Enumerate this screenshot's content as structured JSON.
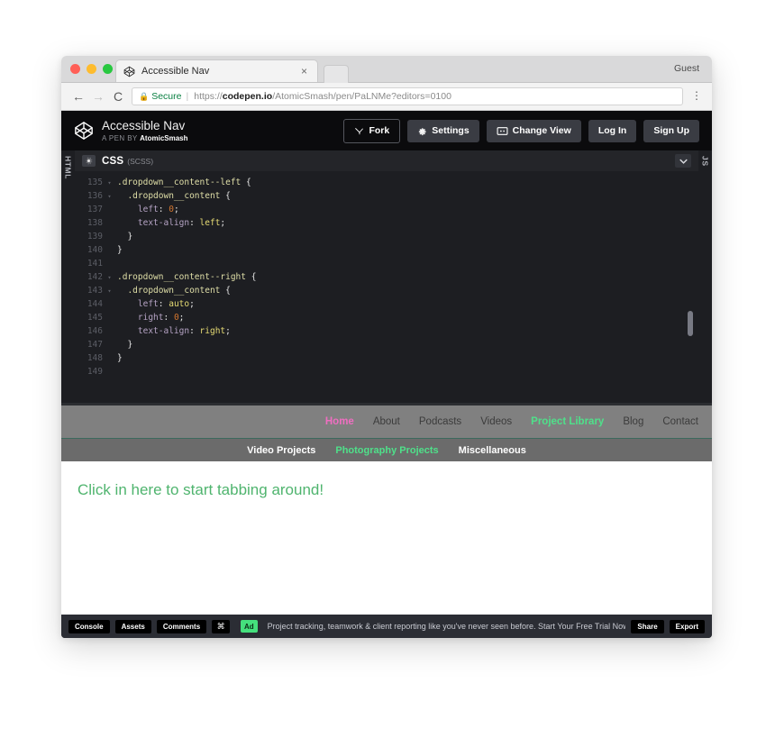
{
  "browser": {
    "tab": {
      "title": "Accessible Nav",
      "favicon": "codepen-logo-icon",
      "close": "×"
    },
    "guest_label": "Guest",
    "address": {
      "secure_label": "Secure",
      "lock": "lock-icon",
      "scheme": "https://",
      "host": "codepen.io",
      "path": "/AtomicSmash/pen/PaLNMe?editors=0100",
      "back": "←",
      "forward": "→",
      "reload": "C",
      "menu": "⋮"
    }
  },
  "pen_header": {
    "title": "Accessible Nav",
    "byline_prefix": "A PEN BY",
    "author": "AtomicSmash",
    "buttons": [
      {
        "label": "Fork",
        "icon": "fork-icon",
        "style": "outline"
      },
      {
        "label": "Settings",
        "icon": "gear-icon",
        "style": "solid"
      },
      {
        "label": "Change View",
        "icon": "layout-icon",
        "style": "solid"
      },
      {
        "label": "Log In",
        "icon": "",
        "style": "solid"
      },
      {
        "label": "Sign Up",
        "icon": "",
        "style": "solid"
      }
    ]
  },
  "editor": {
    "left_tab": "HTML",
    "right_tab": "JS",
    "language": "CSS",
    "sublanguage": "(SCSS)",
    "gear": "gear-icon",
    "collapse": "chevron-down-icon",
    "lines": [
      {
        "n": "135",
        "fold": "▾",
        "tokens": [
          {
            "t": ".dropdown__content--left ",
            "c": "t-sel"
          },
          {
            "t": "{",
            "c": "t-punc"
          }
        ],
        "indent": 0
      },
      {
        "n": "136",
        "fold": "▾",
        "tokens": [
          {
            "t": "  .dropdown__content ",
            "c": "t-sel"
          },
          {
            "t": "{",
            "c": "t-punc"
          }
        ],
        "indent": 0
      },
      {
        "n": "137",
        "fold": "",
        "tokens": [
          {
            "t": "    left",
            "c": "t-prop"
          },
          {
            "t": ": ",
            "c": "t-punc"
          },
          {
            "t": "0",
            "c": "t-num"
          },
          {
            "t": ";",
            "c": "t-punc"
          }
        ],
        "indent": 0
      },
      {
        "n": "138",
        "fold": "",
        "tokens": [
          {
            "t": "    text-align",
            "c": "t-prop"
          },
          {
            "t": ": ",
            "c": "t-punc"
          },
          {
            "t": "left",
            "c": "t-val"
          },
          {
            "t": ";",
            "c": "t-punc"
          }
        ],
        "indent": 0
      },
      {
        "n": "139",
        "fold": "",
        "tokens": [
          {
            "t": "  }",
            "c": "t-punc"
          }
        ],
        "indent": 0
      },
      {
        "n": "140",
        "fold": "",
        "tokens": [
          {
            "t": "}",
            "c": "t-punc"
          }
        ],
        "indent": 0
      },
      {
        "n": "141",
        "fold": "",
        "tokens": [
          {
            "t": "",
            "c": "t-punc"
          }
        ],
        "indent": 0
      },
      {
        "n": "142",
        "fold": "▾",
        "tokens": [
          {
            "t": ".dropdown__content--right ",
            "c": "t-sel"
          },
          {
            "t": "{",
            "c": "t-punc"
          }
        ],
        "indent": 0
      },
      {
        "n": "143",
        "fold": "▾",
        "tokens": [
          {
            "t": "  .dropdown__content ",
            "c": "t-sel"
          },
          {
            "t": "{",
            "c": "t-punc"
          }
        ],
        "indent": 0
      },
      {
        "n": "144",
        "fold": "",
        "tokens": [
          {
            "t": "    left",
            "c": "t-prop"
          },
          {
            "t": ": ",
            "c": "t-punc"
          },
          {
            "t": "auto",
            "c": "t-val"
          },
          {
            "t": ";",
            "c": "t-punc"
          }
        ],
        "indent": 0
      },
      {
        "n": "145",
        "fold": "",
        "tokens": [
          {
            "t": "    right",
            "c": "t-prop"
          },
          {
            "t": ": ",
            "c": "t-punc"
          },
          {
            "t": "0",
            "c": "t-num"
          },
          {
            "t": ";",
            "c": "t-punc"
          }
        ],
        "indent": 0
      },
      {
        "n": "146",
        "fold": "",
        "tokens": [
          {
            "t": "    text-align",
            "c": "t-prop"
          },
          {
            "t": ": ",
            "c": "t-punc"
          },
          {
            "t": "right",
            "c": "t-val"
          },
          {
            "t": ";",
            "c": "t-punc"
          }
        ],
        "indent": 0
      },
      {
        "n": "147",
        "fold": "",
        "tokens": [
          {
            "t": "  }",
            "c": "t-punc"
          }
        ],
        "indent": 0
      },
      {
        "n": "148",
        "fold": "",
        "tokens": [
          {
            "t": "}",
            "c": "t-punc"
          }
        ],
        "indent": 0
      },
      {
        "n": "149",
        "fold": "",
        "tokens": [
          {
            "t": "",
            "c": "t-punc"
          }
        ],
        "indent": 0
      }
    ]
  },
  "preview": {
    "primary_nav": [
      {
        "label": "Home",
        "state": "home"
      },
      {
        "label": "About",
        "state": ""
      },
      {
        "label": "Podcasts",
        "state": ""
      },
      {
        "label": "Videos",
        "state": ""
      },
      {
        "label": "Project Library",
        "state": "active"
      },
      {
        "label": "Blog",
        "state": ""
      },
      {
        "label": "Contact",
        "state": ""
      }
    ],
    "secondary_nav": [
      {
        "label": "Video Projects",
        "state": ""
      },
      {
        "label": "Photography Projects",
        "state": "active"
      },
      {
        "label": "Miscellaneous",
        "state": ""
      }
    ],
    "heading": "Click in here to start tabbing around!"
  },
  "bottom_bar": {
    "buttons": [
      "Console",
      "Assets",
      "Comments"
    ],
    "shortcut_icon": "⌘",
    "ad_badge": "Ad",
    "ad_text": "Project tracking, teamwork & client reporting like you've never seen before. Start Your Free Trial Now",
    "right_buttons": [
      "Share",
      "Export"
    ]
  },
  "colors": {
    "accent_green": "#4fe08a",
    "accent_pink": "#ef6ec1",
    "secure_green": "#0b8043",
    "editor_bg": "#1d1e22",
    "header_bg": "#0b0b0d"
  }
}
